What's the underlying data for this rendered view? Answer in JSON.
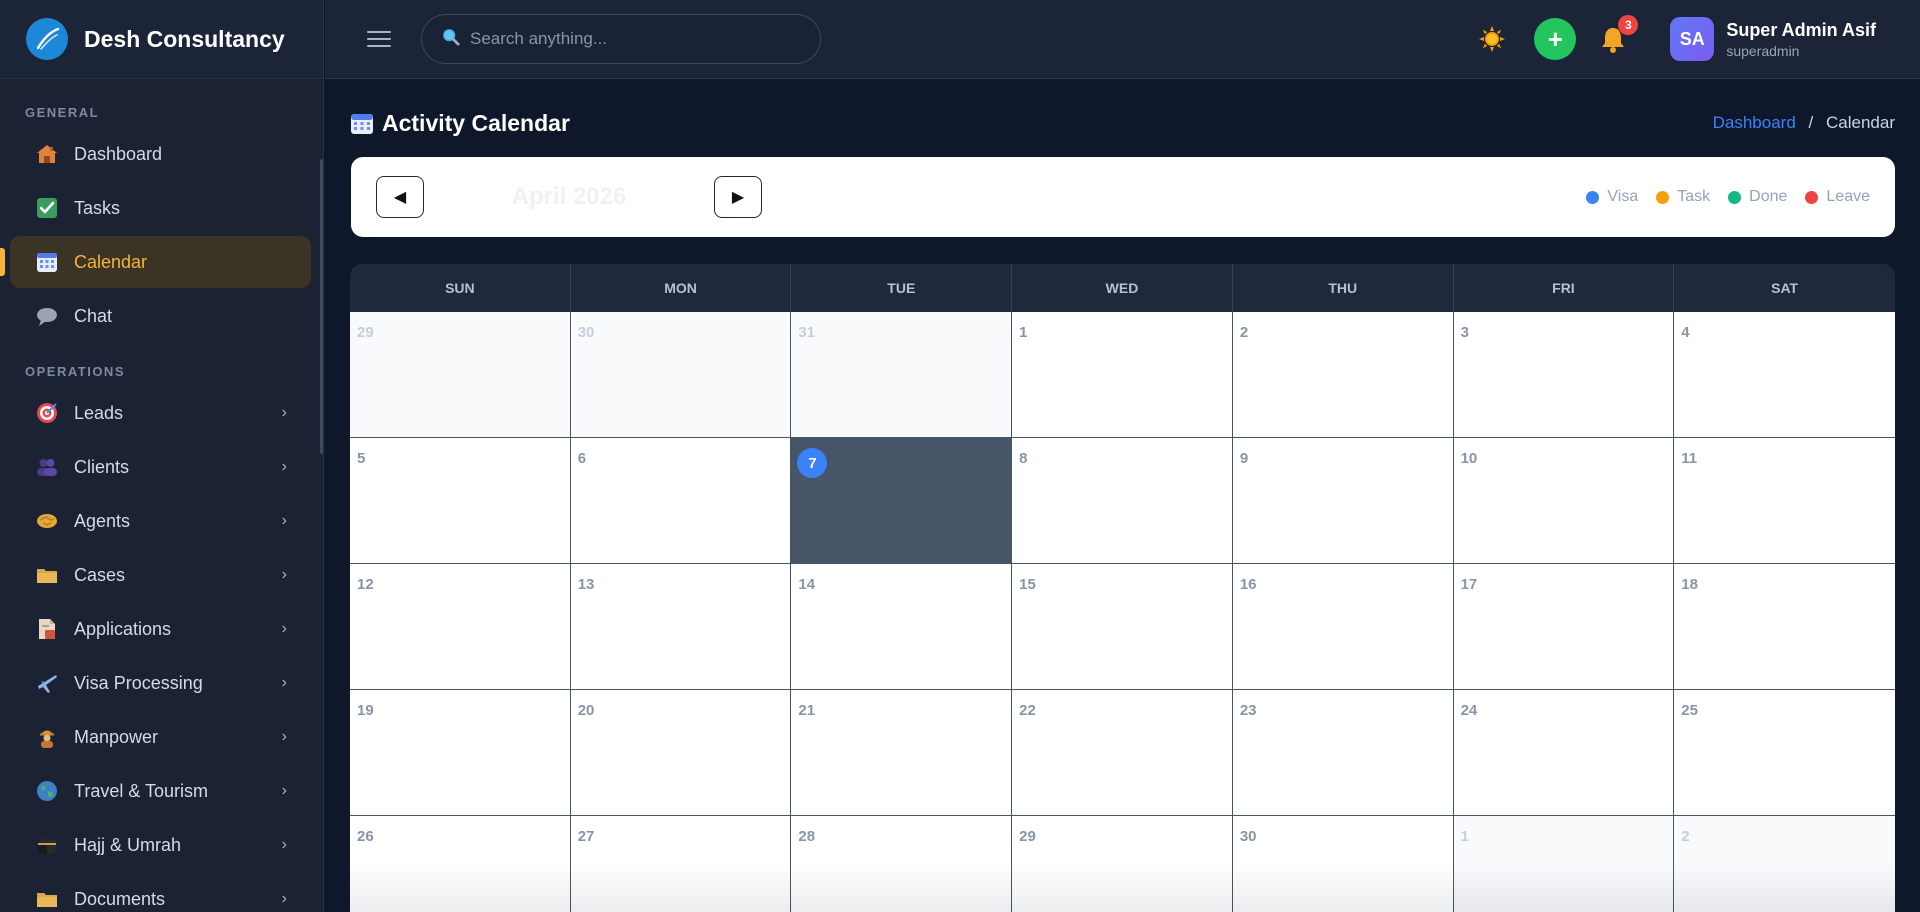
{
  "app": {
    "name": "Desh Consultancy"
  },
  "colors": {
    "accent": "#f5b43a",
    "primary": "#3b82f6",
    "success": "#22c55e",
    "danger": "#ef4444"
  },
  "sidebar": {
    "sections": [
      {
        "label": "GENERAL",
        "items": [
          {
            "label": "Dashboard",
            "icon": "house-icon",
            "active": false,
            "has_children": false
          },
          {
            "label": "Tasks",
            "icon": "checkbox-icon",
            "active": false,
            "has_children": false
          },
          {
            "label": "Calendar",
            "icon": "calendar-icon",
            "active": true,
            "has_children": false
          },
          {
            "label": "Chat",
            "icon": "speech-bubble-icon",
            "active": false,
            "has_children": false
          }
        ]
      },
      {
        "label": "OPERATIONS",
        "items": [
          {
            "label": "Leads",
            "icon": "target-icon",
            "active": false,
            "has_children": true
          },
          {
            "label": "Clients",
            "icon": "people-icon",
            "active": false,
            "has_children": true
          },
          {
            "label": "Agents",
            "icon": "handshake-icon",
            "active": false,
            "has_children": true
          },
          {
            "label": "Cases",
            "icon": "folder-icon",
            "active": false,
            "has_children": true
          },
          {
            "label": "Applications",
            "icon": "document-icon",
            "active": false,
            "has_children": true
          },
          {
            "label": "Visa Processing",
            "icon": "airplane-icon",
            "active": false,
            "has_children": true
          },
          {
            "label": "Manpower",
            "icon": "worker-icon",
            "active": false,
            "has_children": true
          },
          {
            "label": "Travel & Tourism",
            "icon": "globe-icon",
            "active": false,
            "has_children": true
          },
          {
            "label": "Hajj & Umrah",
            "icon": "kaaba-icon",
            "active": false,
            "has_children": true
          },
          {
            "label": "Documents",
            "icon": "folder-icon",
            "active": false,
            "has_children": true
          }
        ]
      }
    ]
  },
  "header": {
    "search_placeholder": "Search anything...",
    "notifications_count": "3",
    "user": {
      "initials": "SA",
      "name": "Super Admin Asif",
      "role": "superadmin"
    }
  },
  "page": {
    "title": "Activity Calendar",
    "breadcrumb": {
      "link": "Dashboard",
      "separator": "/",
      "current": "Calendar"
    }
  },
  "calendar": {
    "month_label": "April 2026",
    "prev_label": "◀",
    "next_label": "▶",
    "legend": [
      {
        "label": "Visa",
        "color": "#3b82f6"
      },
      {
        "label": "Task",
        "color": "#f59e0b"
      },
      {
        "label": "Done",
        "color": "#10b981"
      },
      {
        "label": "Leave",
        "color": "#ef4444"
      }
    ],
    "weekdays": [
      "SUN",
      "MON",
      "TUE",
      "WED",
      "THU",
      "FRI",
      "SAT"
    ],
    "today": "7",
    "weeks": [
      [
        {
          "d": "29",
          "other": true
        },
        {
          "d": "30",
          "other": true
        },
        {
          "d": "31",
          "other": true
        },
        {
          "d": "1"
        },
        {
          "d": "2"
        },
        {
          "d": "3"
        },
        {
          "d": "4"
        }
      ],
      [
        {
          "d": "5"
        },
        {
          "d": "6"
        },
        {
          "d": "7",
          "today": true
        },
        {
          "d": "8"
        },
        {
          "d": "9"
        },
        {
          "d": "10"
        },
        {
          "d": "11"
        }
      ],
      [
        {
          "d": "12"
        },
        {
          "d": "13"
        },
        {
          "d": "14"
        },
        {
          "d": "15"
        },
        {
          "d": "16"
        },
        {
          "d": "17"
        },
        {
          "d": "18"
        }
      ],
      [
        {
          "d": "19"
        },
        {
          "d": "20"
        },
        {
          "d": "21"
        },
        {
          "d": "22"
        },
        {
          "d": "23"
        },
        {
          "d": "24"
        },
        {
          "d": "25"
        }
      ],
      [
        {
          "d": "26"
        },
        {
          "d": "27"
        },
        {
          "d": "28"
        },
        {
          "d": "29"
        },
        {
          "d": "30"
        },
        {
          "d": "1",
          "other": true
        },
        {
          "d": "2",
          "other": true
        }
      ]
    ]
  }
}
